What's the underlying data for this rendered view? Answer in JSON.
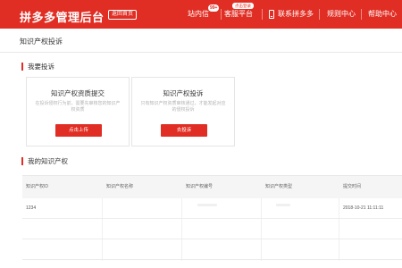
{
  "header": {
    "brand": "拼多多",
    "title": "管理后台",
    "home_btn": "返回首页",
    "nav": {
      "messages": "站内信",
      "messages_badge": "99+",
      "service": "客服平台",
      "service_tip": "点击登录",
      "contact": "联系拼多多",
      "rules": "规则中心",
      "help": "帮助中心"
    }
  },
  "page": {
    "title": "知识产权投诉"
  },
  "complaint_section": {
    "title": "我要投诉",
    "cards": [
      {
        "title": "知识产权资质提交",
        "desc": "在投诉侵权行为前，需要先审核您的知识产权资质",
        "button": "点击上传"
      },
      {
        "title": "知识产权投诉",
        "desc": "只有知识产权资质审核通过，才能发起对应的侵权投诉",
        "button": "去投诉"
      }
    ]
  },
  "ip_section": {
    "title": "我的知识产权",
    "columns": [
      "知识产权ID",
      "知识产权名称",
      "知识产权编号",
      "知识产权类型",
      "提交时间"
    ],
    "rows": [
      {
        "id": "1234",
        "name": "",
        "number": "",
        "type": "",
        "time": "2018-10-21 11:11:11"
      }
    ]
  },
  "colors": {
    "primary": "#e02e24"
  }
}
